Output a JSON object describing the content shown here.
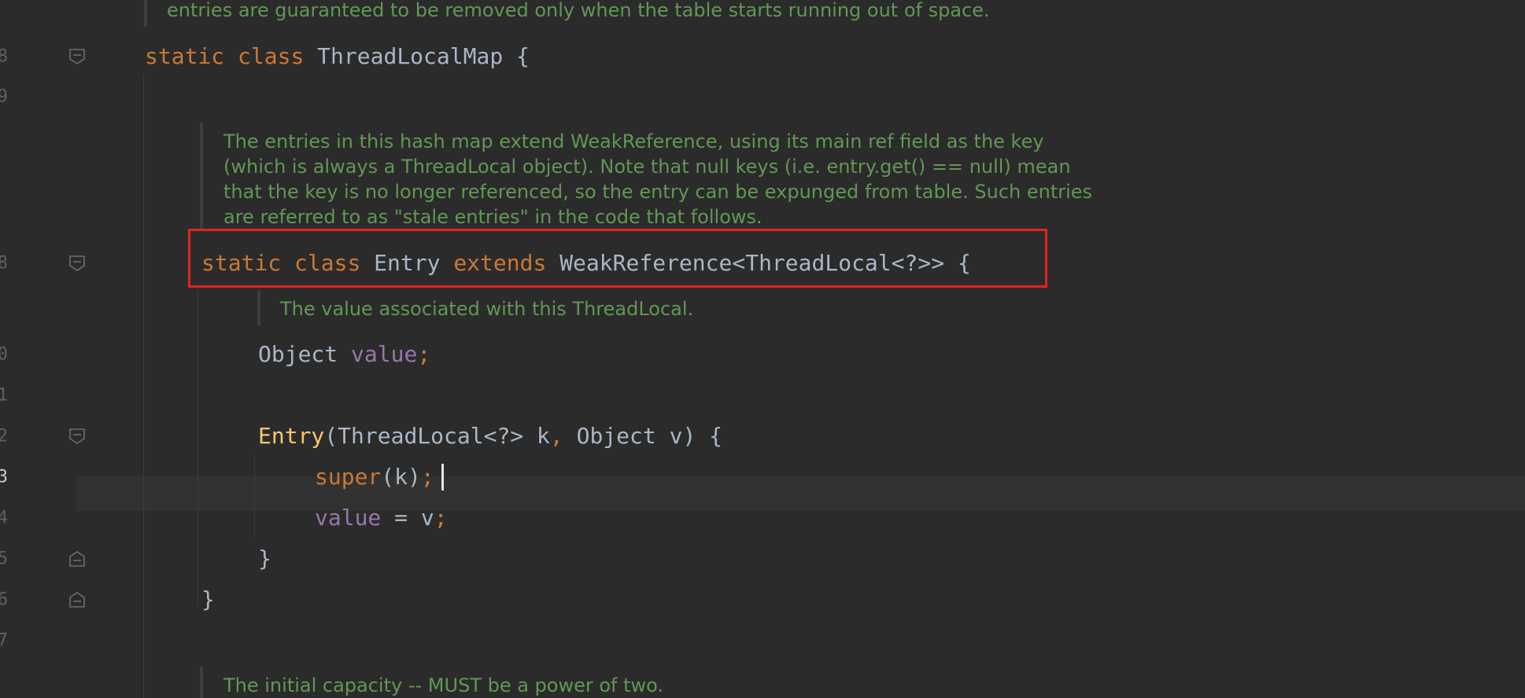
{
  "gutter": {
    "line_numbers": [
      "8",
      "9",
      "8",
      "0",
      "1",
      "2",
      "3",
      "4",
      "5",
      "6",
      "7"
    ],
    "current_line": "3"
  },
  "docs": {
    "top_comment": "entries are guaranteed to be removed only when the table starts running out of space.",
    "entries_comment": [
      "The entries in this hash map extend WeakReference, using its main ref field as the key",
      "(which is always a ThreadLocal object). Note that null keys (i.e. entry.get() == null) mean",
      "that the key is no longer referenced, so the entry can be expunged from table. Such entries",
      "are referred to as \"stale entries\" in the code that follows."
    ],
    "value_comment": "The value associated with this ThreadLocal.",
    "capacity_comment": "The initial capacity -- MUST be a power of two."
  },
  "code": {
    "class_decl": {
      "static_kw": "static",
      "class_kw": "class",
      "name": "ThreadLocalMap",
      "brace": "{"
    },
    "entry_decl": {
      "static_kw": "static",
      "class_kw": "class",
      "name": "Entry",
      "extends_kw": "extends",
      "super_type": "WeakReference<ThreadLocal<?>>",
      "brace": "{"
    },
    "field_decl": {
      "type": "Object",
      "name": "value",
      "semi": ";"
    },
    "constructor_decl": {
      "name": "Entry",
      "params_open": "(ThreadLocal<?> k",
      "comma": ",",
      "params_rest": " Object v) {"
    },
    "super_call": {
      "kw": "super",
      "args": "(k)",
      "semi": ";"
    },
    "assign": {
      "field": "value",
      "rest": " = v",
      "semi": ";"
    },
    "close_constructor": "}",
    "close_entry": "}"
  },
  "colors": {
    "background": "#2b2b2b",
    "keyword": "#cc7832",
    "method": "#ffc66d",
    "field": "#9876aa",
    "identifier": "#a9b7c6",
    "doc_comment": "#629755",
    "highlight_box": "#e0241f"
  },
  "icons": {
    "fold_open": "fold-open-icon",
    "fold_close": "fold-close-icon"
  }
}
